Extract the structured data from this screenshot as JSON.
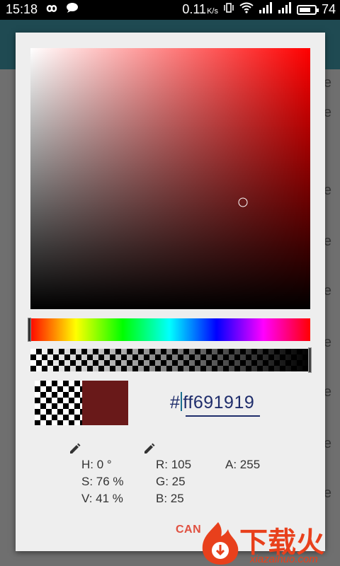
{
  "status_bar": {
    "time": "15:18",
    "speed": "0.11",
    "speed_unit": "K/s",
    "battery": "74",
    "battery_level": 0.74,
    "icons": [
      "infinity-icon",
      "chat-bubble-icon",
      "vibrate-icon",
      "wifi-icon",
      "signal-icon",
      "signal-icon",
      "battery-icon"
    ]
  },
  "background": {
    "item_glyphs": [
      "e",
      "e",
      "e",
      "e",
      "e",
      "e",
      "e",
      "e",
      "e",
      "e"
    ]
  },
  "color_picker": {
    "hue_degrees": 0,
    "saturation": 0.76,
    "value": 0.41,
    "alpha": 1.0,
    "current_color": "#691919",
    "hex_hash": "#",
    "hex_value": "ff691919",
    "hsv": {
      "h": "H: 0 °",
      "s": "S: 76 %",
      "v": "V: 41 %"
    },
    "rgb": {
      "r": "R: 105",
      "g": "G: 25",
      "b": "B: 25"
    },
    "alpha_label": "A: 255",
    "cancel_label": "CAN"
  },
  "watermark": {
    "title": "下载火",
    "subtitle": "xiazaihuo.com",
    "color": "#e8401c"
  }
}
